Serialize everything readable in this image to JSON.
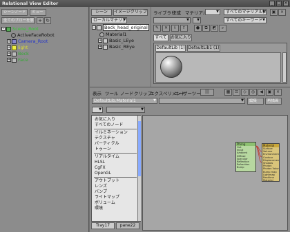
{
  "window": {
    "title": "Relational View Editor"
  },
  "left": {
    "buttons": [
      "シーンノード",
      "ミュー",
      "全てのブローを展開"
    ],
    "tree": [
      {
        "label": "Scene_Root",
        "color": "#33cc33"
      },
      {
        "label": "ActiveFaceRobot",
        "color": "#111111"
      },
      {
        "label": "Camera_Root",
        "color": "#2233cc"
      },
      {
        "label": "light",
        "color": "#e0e040"
      },
      {
        "label": "Beck",
        "color": "#33aa33"
      },
      {
        "label": "Face",
        "color": "#33aa33"
      }
    ]
  },
  "mid": {
    "tabs": [
      "シーン",
      "イメージクリップ"
    ],
    "combo": "ローカルマテリアル",
    "tree": [
      "Beck_head_original",
      "Material1",
      "Basic_LEye",
      "Basic_REye"
    ]
  },
  "rtop": {
    "menu": [
      "ライブラリ",
      "作成",
      "マテリアル"
    ],
    "combo_all_materials": "すべてのマテリアル(A)",
    "combo_all_keywords": "すべてのキーワード",
    "tabs": [
      "すべて",
      "お気に入り"
    ],
    "lib_tabs": [
      "DefaultLib (1)",
      "DefaultLib1 (1)"
    ]
  },
  "bottom": {
    "menu": [
      "表示",
      "ツール",
      "ノード",
      "クリップ",
      "エクスペリメント",
      "ユーザーツール"
    ],
    "path": "DefaultLib.Material1",
    "buttons": [
      "編集",
      "再描画"
    ],
    "list": [
      "お気に入り",
      "すべてのノード",
      "---",
      "イルミネーション",
      "テクスチャ",
      "バーティクル",
      "トゥーン",
      "---",
      "リアルタイム",
      "HLSL",
      "CgFX",
      "OpenGL",
      "---",
      "アウトプット",
      "レンズ",
      "バンプ",
      "ライトマップ",
      "ボリューム",
      "環境"
    ],
    "tabs": [
      "Tray17",
      "pane22"
    ],
    "node1": {
      "title": "Phong",
      "attrs": [
        "Out",
        "Input",
        "Ambient",
        "Diffuse",
        "Specular",
        "Reflection",
        "Refraction",
        "Bump"
      ]
    },
    "node2": {
      "title": "Material",
      "attrs": [
        "Surface",
        "Volume",
        "Environment",
        "Contour",
        "Displacement",
        "Shadow",
        "Photon",
        "Photon Volume",
        "Bump map",
        "Lightmap",
        "Realtime",
        "Material"
      ]
    }
  }
}
